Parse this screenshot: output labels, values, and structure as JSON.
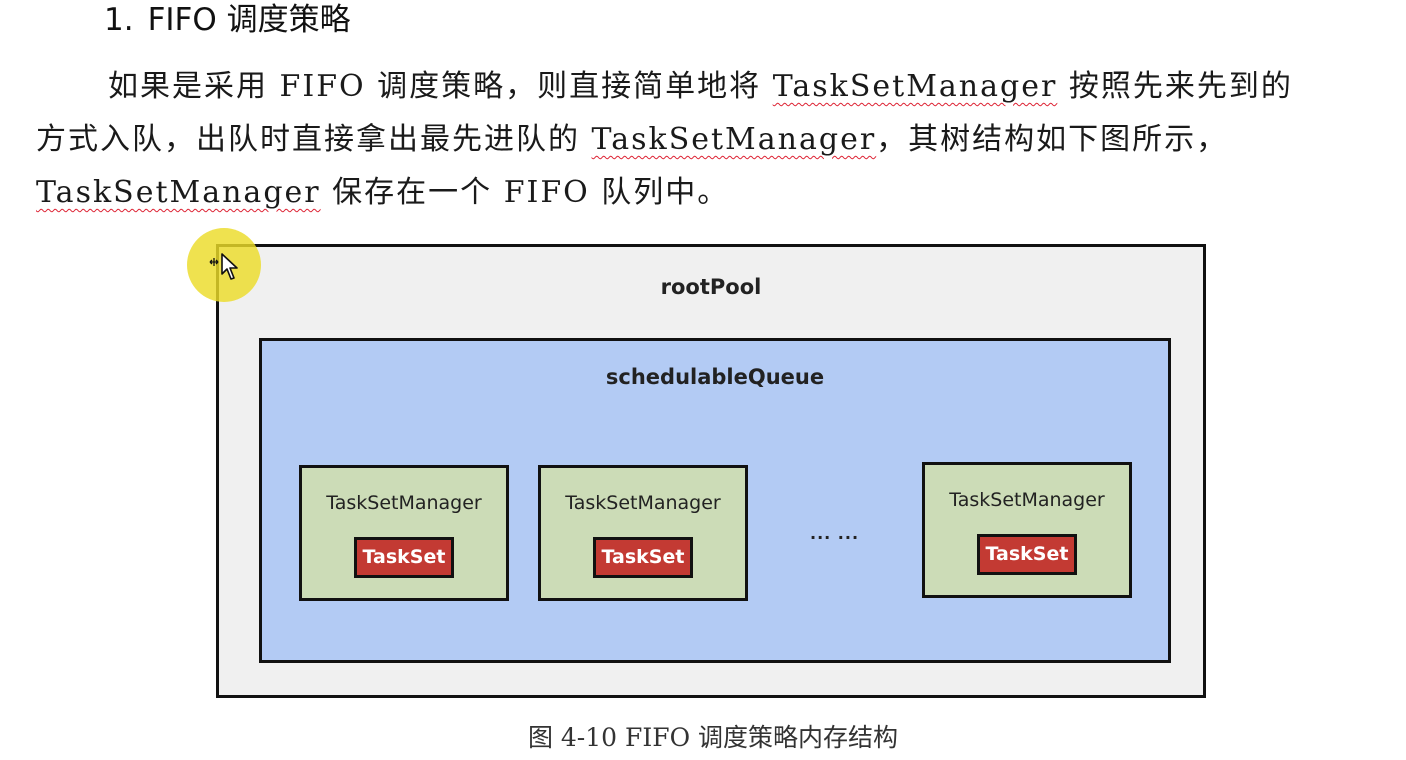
{
  "heading": {
    "number": "1.",
    "title": "FIFO 调度策略"
  },
  "paragraph": {
    "line1": {
      "before": "如果是采用 FIFO 调度策略，则直接简单地将 ",
      "term": "TaskSetManager",
      "after": " 按照先来先到的"
    },
    "line2": {
      "before": "方式入队，出队时直接拿出最先进队的 ",
      "term": "TaskSetManager",
      "after": "，其树结构如下图所示，"
    },
    "line3": {
      "term": "TaskSetManager",
      "after": " 保存在一个 FIFO 队列中。"
    }
  },
  "diagram": {
    "root_label": "rootPool",
    "queue_label": "schedulableQueue",
    "managers": [
      {
        "label": "TaskSetManager",
        "task": "TaskSet"
      },
      {
        "label": "TaskSetManager",
        "task": "TaskSet"
      },
      {
        "label": "TaskSetManager",
        "task": "TaskSet"
      }
    ],
    "ellipsis": "... ..."
  },
  "caption": "图 4-10 FIFO 调度策略内存结构",
  "colors": {
    "root_fill": "#f0f0f0",
    "queue_fill": "#b3cbf4",
    "manager_fill": "#ccdcb7",
    "taskset_fill": "#c33a33",
    "spellcheck_underline": "#d23",
    "cursor_highlight": "#ecdc28"
  },
  "cursor": {
    "icon": "move-cursor-icon"
  }
}
